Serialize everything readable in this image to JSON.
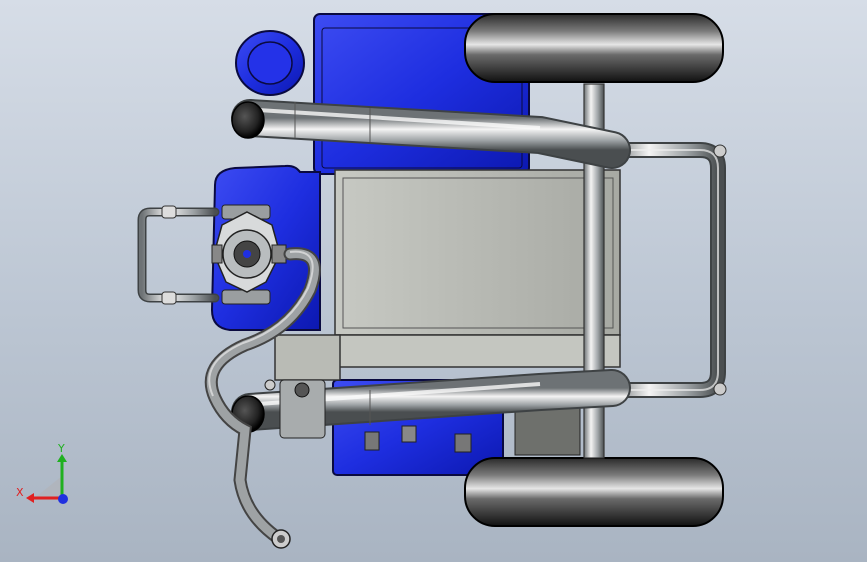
{
  "viewport": {
    "background_top": "#d6dde7",
    "background_bottom": "#a9b4c2"
  },
  "model": {
    "body_color": "#1f2fe0",
    "steel_color": "#b8bcbe",
    "tire_color": "#1a1a1a"
  },
  "triad": {
    "x_label": "X",
    "y_label": "Y",
    "x_color": "#e02020",
    "y_color": "#20b020",
    "z_color": "#2030e0"
  }
}
